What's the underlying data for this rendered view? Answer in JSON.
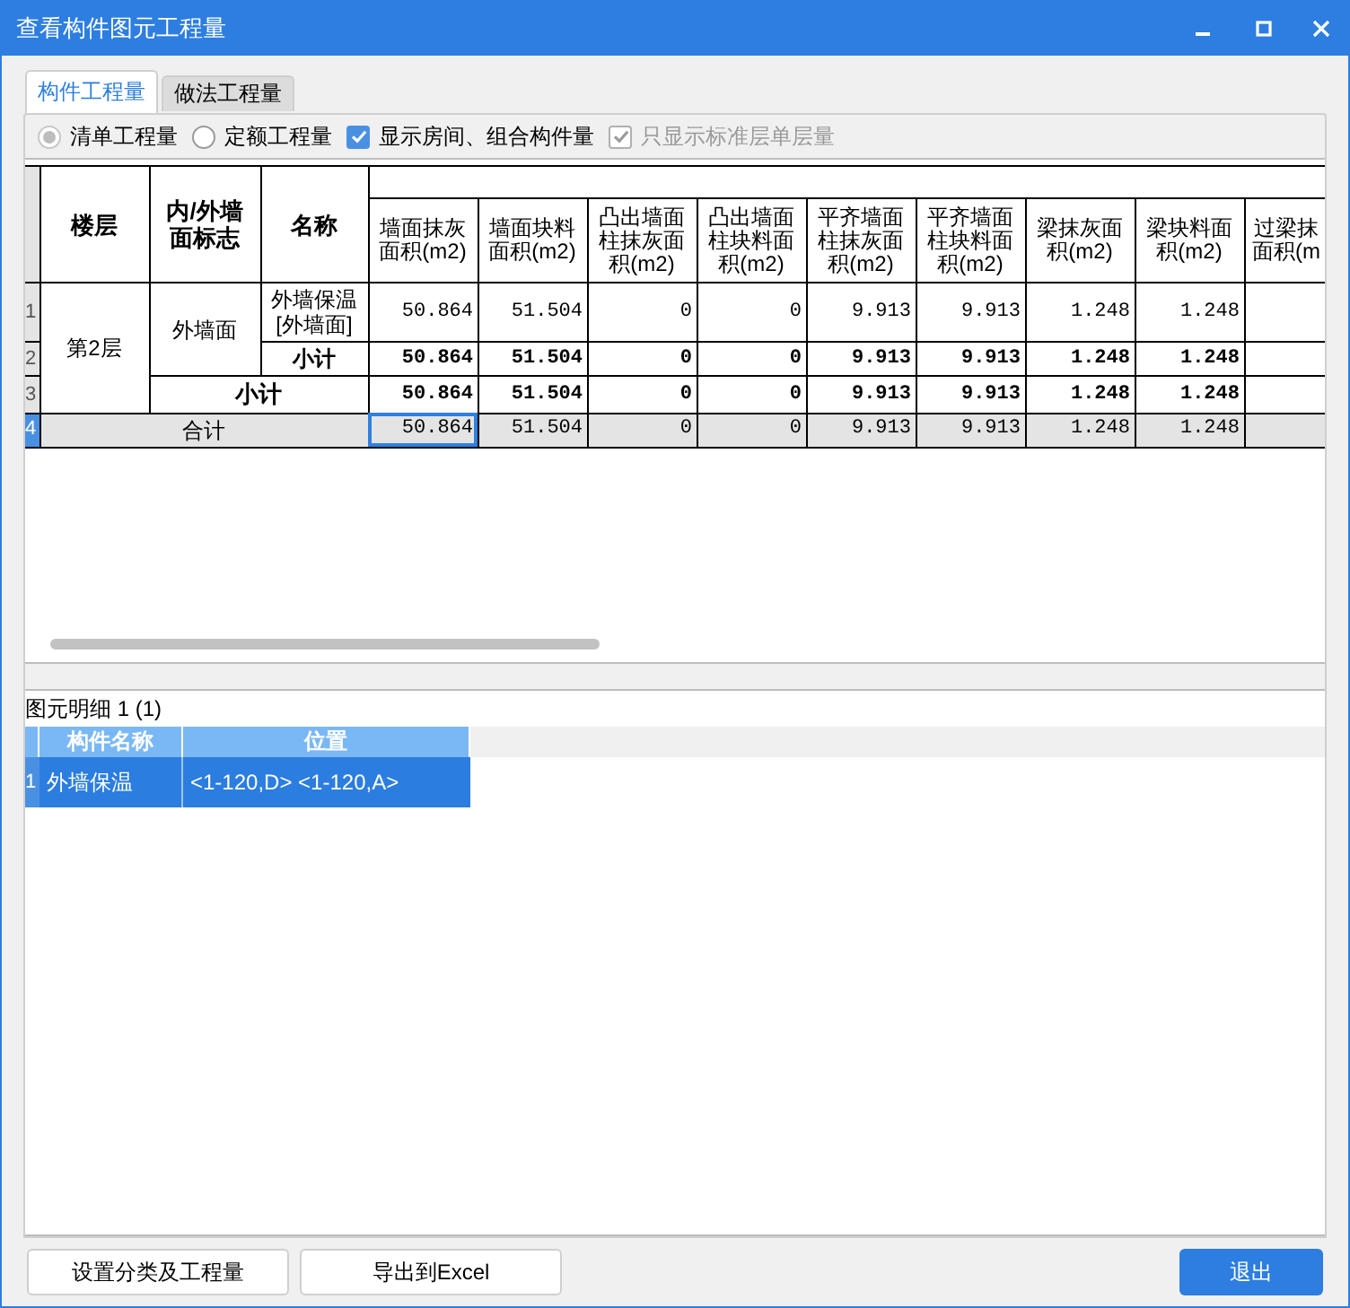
{
  "window": {
    "title": "查看构件图元工程量"
  },
  "tabs": [
    {
      "label": "构件工程量",
      "selected": true
    },
    {
      "label": "做法工程量",
      "selected": false
    }
  ],
  "options": [
    {
      "kind": "radio",
      "label": "清单工程量",
      "checked": true,
      "disabled": true
    },
    {
      "kind": "radio",
      "label": "定额工程量",
      "checked": false,
      "disabled": false
    },
    {
      "kind": "checkbox",
      "label": "显示房间、组合构件量",
      "checked": true,
      "disabled": false
    },
    {
      "kind": "checkbox",
      "label": "只显示标准层单层量",
      "checked": true,
      "disabled": true
    }
  ],
  "table": {
    "columns": [
      "楼层",
      "内/外墙面标志",
      "名称"
    ],
    "value_columns": [
      "墙面抹灰面积(m2)",
      "墙面块料面积(m2)",
      "凸出墙面柱抹灰面积(m2)",
      "凸出墙面柱块料面积(m2)",
      "平齐墙面柱抹灰面积(m2)",
      "平齐墙面柱块料面积(m2)",
      "梁抹灰面积(m2)",
      "梁块料面积(m2)",
      "过梁抹面积(m"
    ],
    "rows": [
      {
        "num": "1",
        "kind": "item",
        "floor": "第2层",
        "side": "外墙面",
        "name": "外墙保温[外墙面]",
        "selected": false,
        "values": [
          "50.864",
          "51.504",
          "0",
          "0",
          "9.913",
          "9.913",
          "1.248",
          "1.248"
        ]
      },
      {
        "num": "2",
        "kind": "subtotal",
        "name": "小计",
        "selected": false,
        "values": [
          "50.864",
          "51.504",
          "0",
          "0",
          "9.913",
          "9.913",
          "1.248",
          "1.248"
        ]
      },
      {
        "num": "3",
        "kind": "group_total",
        "label": "小计",
        "selected": false,
        "values": [
          "50.864",
          "51.504",
          "0",
          "0",
          "9.913",
          "9.913",
          "1.248",
          "1.248"
        ]
      },
      {
        "num": "4",
        "kind": "total",
        "label": "合计",
        "selected": true,
        "values": [
          "50.864",
          "51.504",
          "0",
          "0",
          "9.913",
          "9.913",
          "1.248",
          "1.248"
        ]
      }
    ]
  },
  "detail": {
    "title": "图元明细  1 (1)",
    "columns": [
      "构件名称",
      "位置"
    ],
    "rows": [
      {
        "num": "1",
        "name": "外墙保温",
        "position": "<1-120,D> <1-120,A>",
        "selected": true
      }
    ]
  },
  "buttons": [
    {
      "label": "设置分类及工程量",
      "primary": false
    },
    {
      "label": "导出到Excel",
      "primary": false
    },
    {
      "label": "退出",
      "primary": true
    }
  ]
}
